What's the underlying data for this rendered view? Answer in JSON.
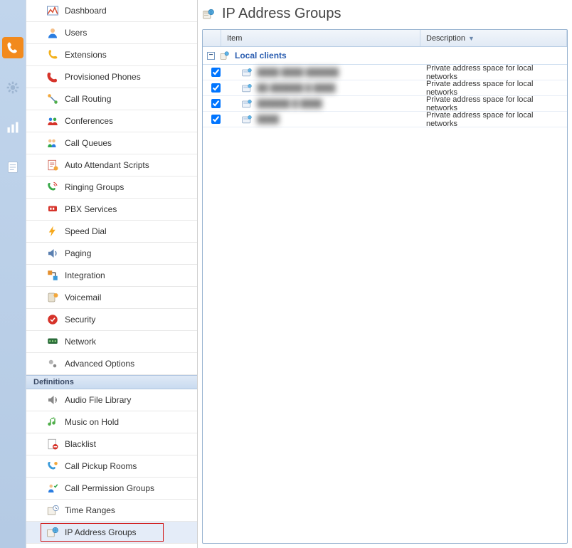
{
  "edge_tabs": [
    {
      "name": "phone",
      "active": true
    },
    {
      "name": "gear",
      "active": false
    },
    {
      "name": "stats",
      "active": false
    },
    {
      "name": "notes",
      "active": false
    }
  ],
  "sidebar": {
    "main": [
      {
        "label": "Dashboard",
        "icon": "dashboard"
      },
      {
        "label": "Users",
        "icon": "user"
      },
      {
        "label": "Extensions",
        "icon": "handset"
      },
      {
        "label": "Provisioned Phones",
        "icon": "phone-red"
      },
      {
        "label": "Call Routing",
        "icon": "routing"
      },
      {
        "label": "Conferences",
        "icon": "conference"
      },
      {
        "label": "Call Queues",
        "icon": "queue"
      },
      {
        "label": "Auto Attendant Scripts",
        "icon": "script"
      },
      {
        "label": "Ringing Groups",
        "icon": "ring-group"
      },
      {
        "label": "PBX Services",
        "icon": "pbx"
      },
      {
        "label": "Speed Dial",
        "icon": "lightning"
      },
      {
        "label": "Paging",
        "icon": "speaker"
      },
      {
        "label": "Integration",
        "icon": "integration"
      },
      {
        "label": "Voicemail",
        "icon": "voicemail"
      },
      {
        "label": "Security",
        "icon": "security"
      },
      {
        "label": "Network",
        "icon": "network"
      },
      {
        "label": "Advanced Options",
        "icon": "gears"
      }
    ],
    "section_label": "Definitions",
    "definitions": [
      {
        "label": "Audio File Library",
        "icon": "audio"
      },
      {
        "label": "Music on Hold",
        "icon": "music"
      },
      {
        "label": "Blacklist",
        "icon": "blacklist"
      },
      {
        "label": "Call Pickup Rooms",
        "icon": "pickup"
      },
      {
        "label": "Call Permission Groups",
        "icon": "permission"
      },
      {
        "label": "Time Ranges",
        "icon": "time"
      },
      {
        "label": "IP Address Groups",
        "icon": "ip-group",
        "selected": true
      }
    ]
  },
  "page": {
    "title": "IP Address Groups",
    "columns": {
      "item": "Item",
      "description": "Description"
    },
    "group": {
      "name": "Local clients",
      "rows": [
        {
          "item": "████ ████ ██████",
          "desc": "Private address space for local networks",
          "checked": true
        },
        {
          "item": "██ ██████ █ ████",
          "desc": "Private address space for local networks",
          "checked": true
        },
        {
          "item": "██████ █ ████",
          "desc": "Private address space for local networks",
          "checked": true
        },
        {
          "item": "████",
          "desc": "Private address space for local networks",
          "checked": true
        }
      ]
    }
  }
}
